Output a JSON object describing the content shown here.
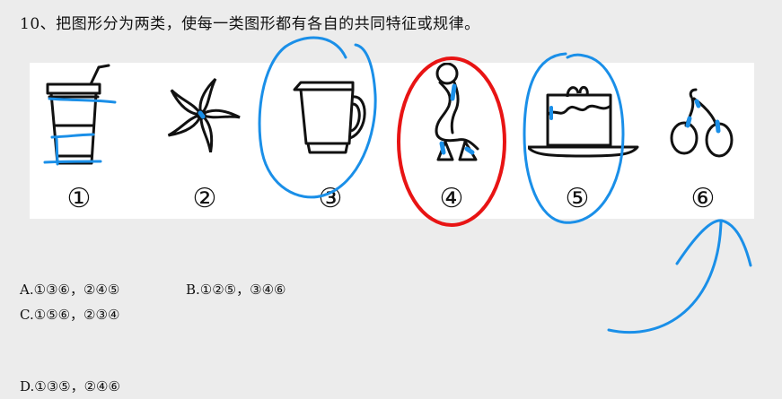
{
  "question": {
    "title": "10、把图形分为两类，使每一类图形都有各自的共同特征或规律。"
  },
  "figures": [
    {
      "number": "①",
      "icon": "drink-cup-icon"
    },
    {
      "number": "②",
      "icon": "pinwheel-icon"
    },
    {
      "number": "③",
      "icon": "pitcher-icon"
    },
    {
      "number": "④",
      "icon": "goose-icon"
    },
    {
      "number": "⑤",
      "icon": "cake-icon"
    },
    {
      "number": "⑥",
      "icon": "cherries-icon"
    }
  ],
  "options": {
    "a": "A.①③⑥，②④⑤",
    "b": "B.①②⑤，③④⑥",
    "c": "C.①⑤⑥，②③④",
    "d": "D.①③⑤，②④⑥"
  },
  "annotation_colors": {
    "blue": "#1a8fe8",
    "red": "#e81414"
  }
}
